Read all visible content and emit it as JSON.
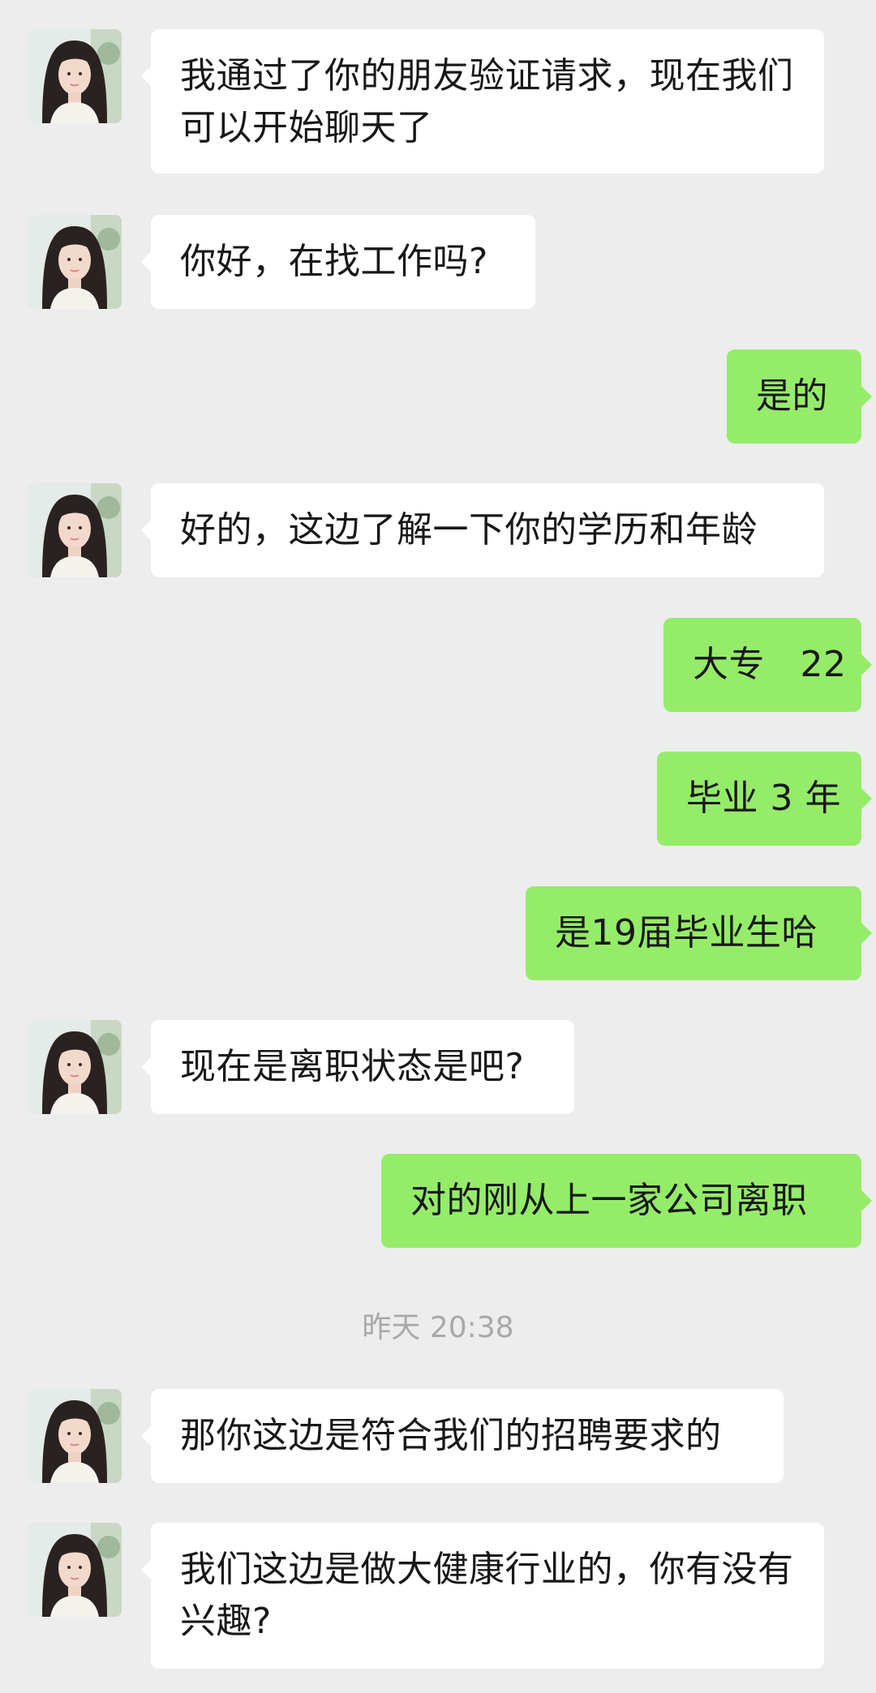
{
  "conversation": {
    "messages": [
      {
        "from": "contact",
        "text": "我通过了你的朋友验证请求，现在我们可以开始聊天了"
      },
      {
        "from": "contact",
        "text": "你好，在找工作吗?"
      },
      {
        "from": "me",
        "text": "是的"
      },
      {
        "from": "contact",
        "text": "好的，这边了解一下你的学历和年龄"
      },
      {
        "from": "me",
        "text": "大专   22"
      },
      {
        "from": "me",
        "text": "毕业 3 年"
      },
      {
        "from": "me",
        "text": "是19届毕业生哈"
      },
      {
        "from": "contact",
        "text": "现在是离职状态是吧?"
      },
      {
        "from": "me",
        "text": "对的刚从上一家公司离职"
      },
      {
        "from": "contact",
        "text": "那你这边是符合我们的招聘要求的"
      },
      {
        "from": "contact",
        "text": "我们这边是做大健康行业的，你有没有兴趣?"
      }
    ],
    "timestamp": "昨天 20:38"
  },
  "colors": {
    "background": "#ededed",
    "incoming_bubble": "#ffffff",
    "outgoing_bubble": "#95ec69",
    "timestamp_text": "#a8a8a8"
  },
  "icons": {
    "contact_avatar": "avatar-portrait"
  }
}
